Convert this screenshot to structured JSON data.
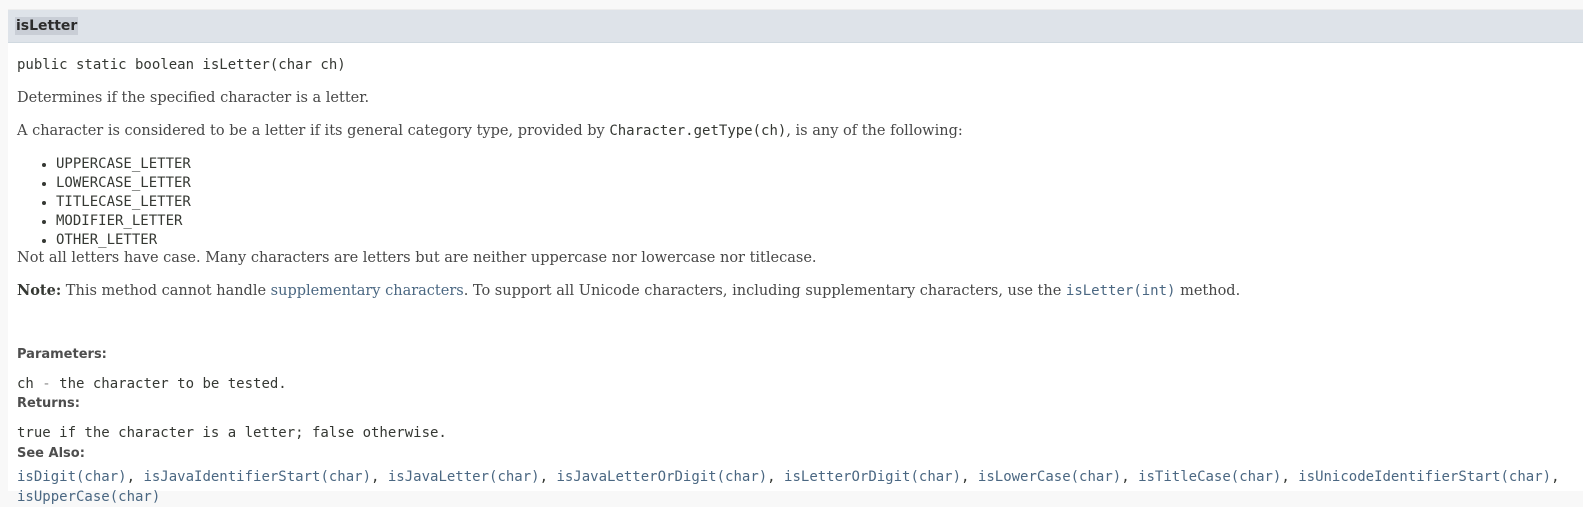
{
  "header": {
    "title": "isLetter"
  },
  "signature": "public static boolean isLetter(char ch)",
  "description": {
    "line1": "Determines if the specified character is a letter.",
    "line2_prefix": "A character is considered to be a letter if its general category type, provided by ",
    "line2_code": "Character.getType(ch)",
    "line2_suffix": ", is any of the following:",
    "categories": [
      "UPPERCASE_LETTER",
      "LOWERCASE_LETTER",
      "TITLECASE_LETTER",
      "MODIFIER_LETTER",
      "OTHER_LETTER"
    ],
    "line3": "Not all letters have case. Many characters are letters but are neither uppercase nor lowercase nor titlecase."
  },
  "note": {
    "label": "Note:",
    "text_before": " This method cannot handle ",
    "link1": "supplementary characters",
    "text_middle": ". To support all Unicode characters, including supplementary characters, use the ",
    "link2": "isLetter(int)",
    "text_after": " method."
  },
  "parameters": {
    "label": "Parameters:",
    "name": "ch",
    "dash": " - ",
    "desc": "the character to be tested."
  },
  "returns": {
    "label": "Returns:",
    "text": "true if the character is a letter; false otherwise."
  },
  "see_also": {
    "label": "See Also:",
    "links": [
      "isDigit(char)",
      "isJavaIdentifierStart(char)",
      "isJavaLetter(char)",
      "isJavaLetterOrDigit(char)",
      "isLetterOrDigit(char)",
      "isLowerCase(char)",
      "isTitleCase(char)",
      "isUnicodeIdentifierStart(char)",
      "isUpperCase(char)"
    ],
    "separator": ", "
  }
}
